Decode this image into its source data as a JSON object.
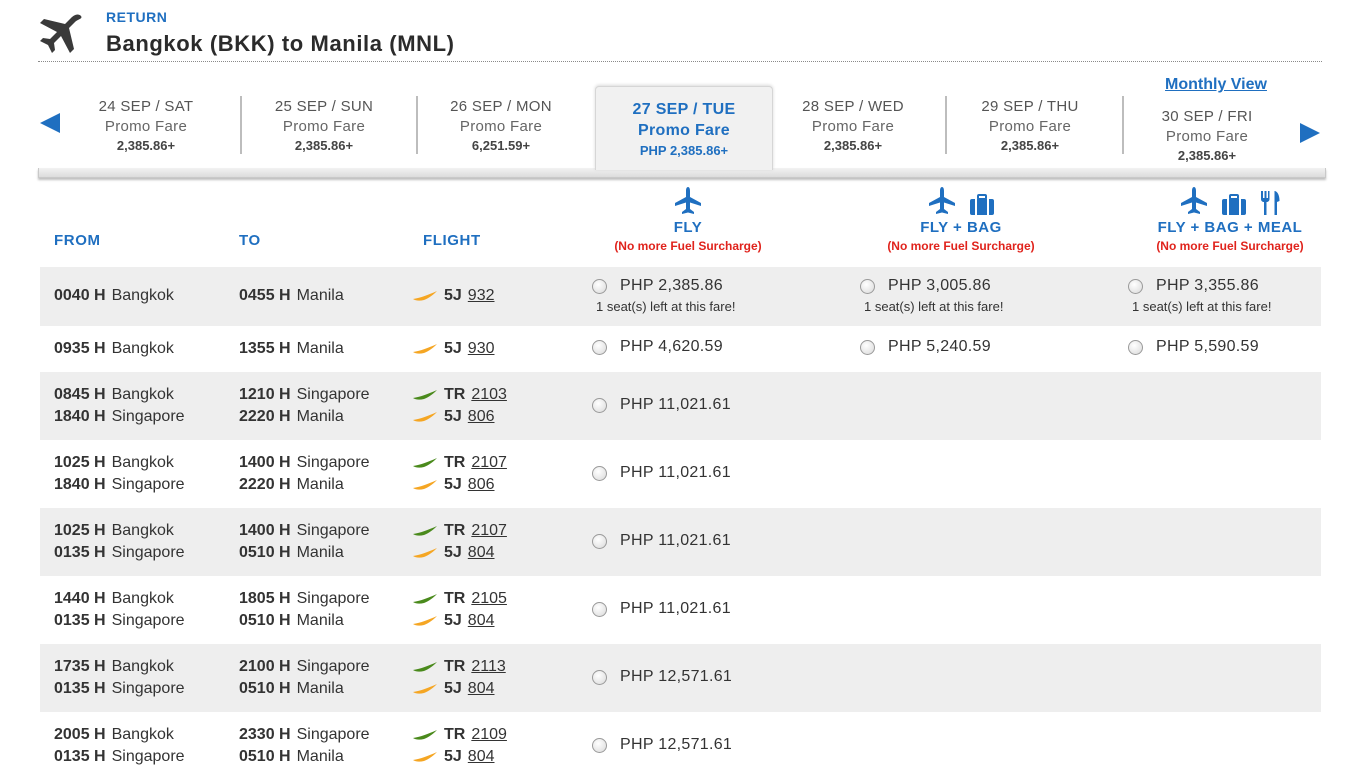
{
  "header": {
    "return_label": "RETURN",
    "route_title": "Bangkok (BKK) to Manila (MNL)",
    "icon": "airplane-icon"
  },
  "date_bar": {
    "monthly_view": "Monthly View",
    "dates": [
      {
        "date": "24 SEP / SAT",
        "fare": "Promo Fare",
        "price": "2,385.86+"
      },
      {
        "date": "25 SEP / SUN",
        "fare": "Promo Fare",
        "price": "2,385.86+"
      },
      {
        "date": "26 SEP / MON",
        "fare": "Promo Fare",
        "price": "6,251.59+"
      },
      {
        "date": "27 SEP / TUE",
        "fare": "Promo Fare",
        "price": "PHP 2,385.86+",
        "selected": true
      },
      {
        "date": "28 SEP / WED",
        "fare": "Promo Fare",
        "price": "2,385.86+"
      },
      {
        "date": "29 SEP / THU",
        "fare": "Promo Fare",
        "price": "2,385.86+"
      },
      {
        "date": "30 SEP / FRI",
        "fare": "Promo Fare",
        "price": "2,385.86+"
      }
    ]
  },
  "columns": {
    "from": "FROM",
    "to": "TO",
    "flight": "FLIGHT"
  },
  "fare_types": [
    {
      "title": "FLY",
      "note": "(No more Fuel Surcharge)",
      "icons": [
        "airplane-icon"
      ]
    },
    {
      "title": "FLY + BAG",
      "note": "(No more Fuel Surcharge)",
      "icons": [
        "airplane-icon",
        "luggage-icon"
      ]
    },
    {
      "title": "FLY + BAG + MEAL",
      "note": "(No more Fuel Surcharge)",
      "icons": [
        "airplane-icon",
        "luggage-icon",
        "meal-icon"
      ]
    }
  ],
  "colors": {
    "accent": "#1f6fc0",
    "warning": "#e0231c",
    "cebu_orange": "#f5a623",
    "tigerair_green": "#4a8a1c"
  },
  "flights": [
    {
      "legs": [
        {
          "dep_time": "0040 H",
          "dep_city": "Bangkok",
          "arr_time": "0455 H",
          "arr_city": "Manila",
          "airline": "5J",
          "number": "932"
        }
      ],
      "fares": [
        {
          "price": "PHP 2,385.86",
          "seats": "1 seat(s) left at this fare!"
        },
        {
          "price": "PHP 3,005.86",
          "seats": "1 seat(s) left at this fare!"
        },
        {
          "price": "PHP 3,355.86",
          "seats": "1 seat(s) left at this fare!"
        }
      ]
    },
    {
      "legs": [
        {
          "dep_time": "0935 H",
          "dep_city": "Bangkok",
          "arr_time": "1355 H",
          "arr_city": "Manila",
          "airline": "5J",
          "number": "930"
        }
      ],
      "fares": [
        {
          "price": "PHP 4,620.59"
        },
        {
          "price": "PHP 5,240.59"
        },
        {
          "price": "PHP 5,590.59"
        }
      ]
    },
    {
      "legs": [
        {
          "dep_time": "0845 H",
          "dep_city": "Bangkok",
          "arr_time": "1210 H",
          "arr_city": "Singapore",
          "airline": "TR",
          "number": "2103"
        },
        {
          "dep_time": "1840 H",
          "dep_city": "Singapore",
          "arr_time": "2220 H",
          "arr_city": "Manila",
          "airline": "5J",
          "number": "806"
        }
      ],
      "fares": [
        {
          "price": "PHP 11,021.61"
        }
      ]
    },
    {
      "legs": [
        {
          "dep_time": "1025 H",
          "dep_city": "Bangkok",
          "arr_time": "1400 H",
          "arr_city": "Singapore",
          "airline": "TR",
          "number": "2107"
        },
        {
          "dep_time": "1840 H",
          "dep_city": "Singapore",
          "arr_time": "2220 H",
          "arr_city": "Manila",
          "airline": "5J",
          "number": "806"
        }
      ],
      "fares": [
        {
          "price": "PHP 11,021.61"
        }
      ]
    },
    {
      "legs": [
        {
          "dep_time": "1025 H",
          "dep_city": "Bangkok",
          "arr_time": "1400 H",
          "arr_city": "Singapore",
          "airline": "TR",
          "number": "2107"
        },
        {
          "dep_time": "0135 H",
          "dep_city": "Singapore",
          "arr_time": "0510 H",
          "arr_city": "Manila",
          "airline": "5J",
          "number": "804"
        }
      ],
      "fares": [
        {
          "price": "PHP 11,021.61"
        }
      ]
    },
    {
      "legs": [
        {
          "dep_time": "1440 H",
          "dep_city": "Bangkok",
          "arr_time": "1805 H",
          "arr_city": "Singapore",
          "airline": "TR",
          "number": "2105"
        },
        {
          "dep_time": "0135 H",
          "dep_city": "Singapore",
          "arr_time": "0510 H",
          "arr_city": "Manila",
          "airline": "5J",
          "number": "804"
        }
      ],
      "fares": [
        {
          "price": "PHP 11,021.61"
        }
      ]
    },
    {
      "legs": [
        {
          "dep_time": "1735 H",
          "dep_city": "Bangkok",
          "arr_time": "2100 H",
          "arr_city": "Singapore",
          "airline": "TR",
          "number": "2113"
        },
        {
          "dep_time": "0135 H",
          "dep_city": "Singapore",
          "arr_time": "0510 H",
          "arr_city": "Manila",
          "airline": "5J",
          "number": "804"
        }
      ],
      "fares": [
        {
          "price": "PHP 12,571.61"
        }
      ]
    },
    {
      "legs": [
        {
          "dep_time": "2005 H",
          "dep_city": "Bangkok",
          "arr_time": "2330 H",
          "arr_city": "Singapore",
          "airline": "TR",
          "number": "2109"
        },
        {
          "dep_time": "0135 H",
          "dep_city": "Singapore",
          "arr_time": "0510 H",
          "arr_city": "Manila",
          "airline": "5J",
          "number": "804"
        }
      ],
      "fares": [
        {
          "price": "PHP 12,571.61"
        }
      ]
    }
  ]
}
